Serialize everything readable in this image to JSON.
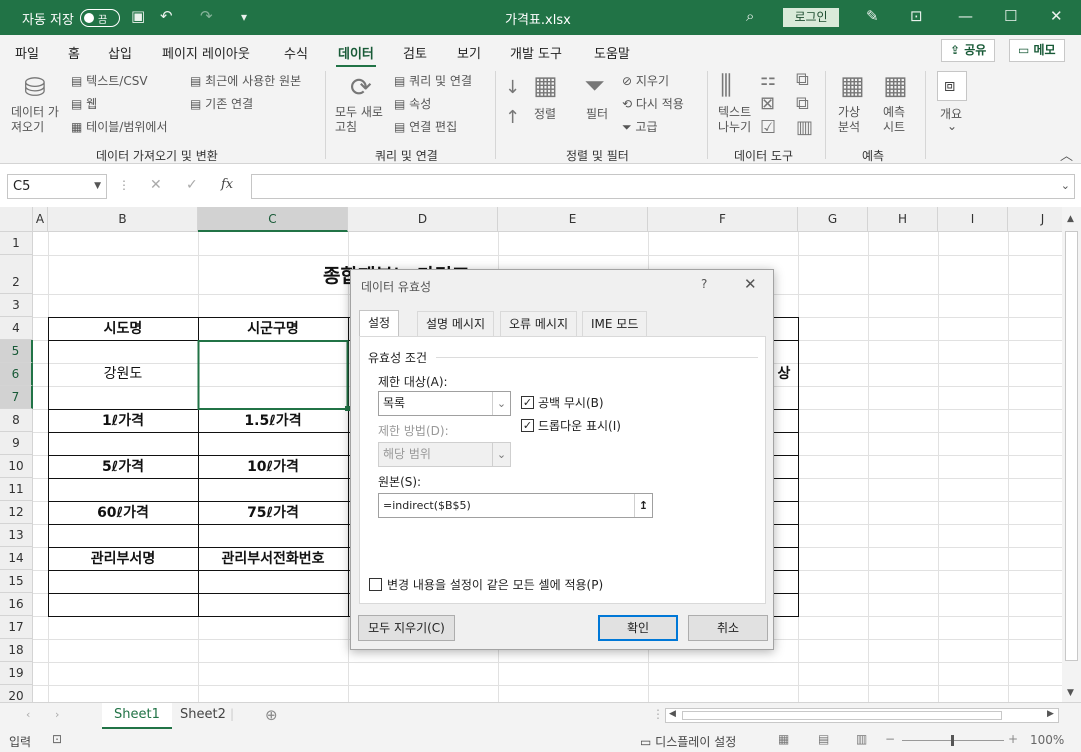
{
  "titlebar": {
    "autosave_label": "자동 저장",
    "autosave_state": "끔",
    "filename": "가격표.xlsx",
    "login": "로그인"
  },
  "menu": {
    "tabs": [
      "파일",
      "홈",
      "삽입",
      "페이지 레이아웃",
      "수식",
      "데이터",
      "검토",
      "보기",
      "개발 도구",
      "도움말"
    ],
    "active": "데이터",
    "share": "공유",
    "comments": "메모"
  },
  "ribbon": {
    "get_data": "데이터 가\n져오기",
    "from_text_csv": "텍스트/CSV",
    "from_web": "웹",
    "from_table": "테이블/범위에서",
    "recent_sources": "최근에 사용한 원본",
    "existing_connections": "기존 연결",
    "group_get": "데이터 가져오기 및 변환",
    "refresh_all": "모두 새로\n고침",
    "queries_connections": "쿼리 및 연결",
    "properties": "속성",
    "edit_links": "연결 편집",
    "group_queries": "쿼리 및 연결",
    "sort": "정렬",
    "filter": "필터",
    "clear": "지우기",
    "reapply": "다시 적용",
    "advanced": "고급",
    "group_sort": "정렬 및 필터",
    "text_to_columns": "텍스트\n나누기",
    "group_tools": "데이터 도구",
    "whatif": "가상\n분석",
    "forecast_sheet": "예측\n시트",
    "group_forecast": "예측",
    "outline": "개요"
  },
  "formula_bar": {
    "name_box": "C5",
    "formula": ""
  },
  "columns": [
    "A",
    "B",
    "C",
    "D",
    "E",
    "F",
    "G",
    "H",
    "I",
    "J"
  ],
  "rows": [
    "1",
    "2",
    "3",
    "4",
    "5",
    "6",
    "7",
    "8",
    "9",
    "10",
    "11",
    "12",
    "13",
    "14",
    "15",
    "16",
    "17",
    "18",
    "19",
    "20"
  ],
  "cells": {
    "title": "종합재분뇨 가격표",
    "b4": "시도명",
    "c4": "시군구명",
    "b6": "강원도",
    "f6": "상",
    "b8": "1ℓ가격",
    "c8": "1.5ℓ가격",
    "b10": "5ℓ가격",
    "c10": "10ℓ가격",
    "b12": "60ℓ가격",
    "c12": "75ℓ가격",
    "b14": "관리부서명",
    "c14": "관리부서전화번호"
  },
  "sheets": [
    "Sheet1",
    "Sheet2"
  ],
  "active_sheet": "Sheet1",
  "status": {
    "mode": "입력",
    "display_settings": "디스플레이 설정",
    "zoom": "100%"
  },
  "dialog": {
    "title": "데이터 유효성",
    "help": "?",
    "tabs": [
      "설정",
      "설명 메시지",
      "오류 메시지",
      "IME 모드"
    ],
    "active_tab": "설정",
    "section": "유효성 조건",
    "allow_label": "제한 대상(A):",
    "allow_value": "목록",
    "data_label": "제한 방법(D):",
    "data_value": "해당 범위",
    "ignore_blank": "공백 무시(B)",
    "ignore_blank_checked": true,
    "in_cell_dropdown": "드롭다운 표시(I)",
    "in_cell_dropdown_checked": true,
    "source_label": "원본(S):",
    "source_value": "=indirect($B$5)",
    "apply_all": "변경 내용을 설정이 같은 모든 셀에 적용(P)",
    "apply_all_checked": false,
    "clear_all": "모두 지우기(C)",
    "ok": "확인",
    "cancel": "취소"
  }
}
